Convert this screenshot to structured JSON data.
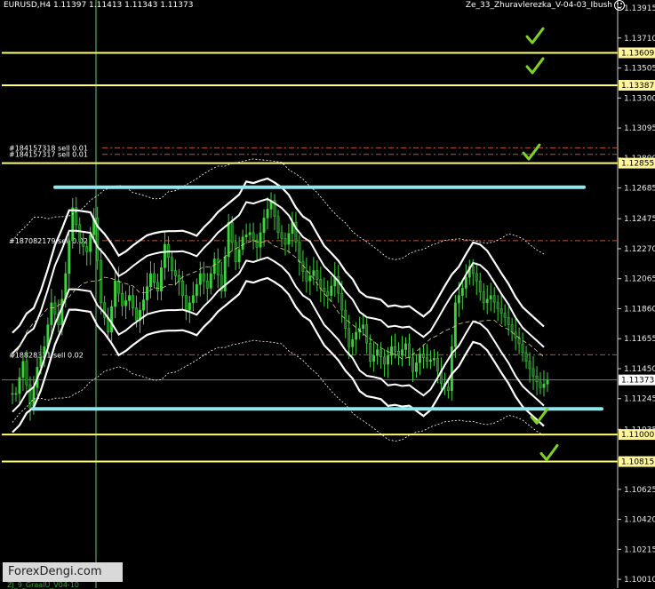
{
  "header": {
    "symbol": "EURUSD,H4  1.11397 1.11413 1.11343 1.11373",
    "indicator": "Ze_33_Zhuravlerezka_V-04-03_Ibush"
  },
  "watermark": "ForexDengi.com",
  "footer": "ZJ_9_GraalU_V04-10",
  "colors": {
    "background": "#000000",
    "candle": "#3fd23f",
    "band": "#ffffff",
    "support_resistance": "#ffff66",
    "channel": "#8ee8f0",
    "check": "#7ed321"
  },
  "chart_data": {
    "type": "candlestick",
    "symbol": "EURUSD",
    "timeframe": "H4",
    "ohlc_last": {
      "open": 1.11397,
      "high": 1.11413,
      "low": 1.11343,
      "close": 1.11373
    },
    "ylim": [
      1.0995,
      1.1397
    ],
    "y_ticks": [
      "1.13915",
      "1.13710",
      "1.13505",
      "1.13300",
      "1.13095",
      "1.12890",
      "1.12685",
      "1.12475",
      "1.12270",
      "1.12065",
      "1.11860",
      "1.11655",
      "1.11450",
      "1.11245",
      "1.11035",
      "1.10830",
      "1.10625",
      "1.10420",
      "1.10215",
      "1.10010"
    ],
    "price_labels": [
      {
        "value": 1.13609,
        "label": "1.13609",
        "kind": "yellow"
      },
      {
        "value": 1.13387,
        "label": "1.13387",
        "kind": "yellow"
      },
      {
        "value": 1.12855,
        "label": "1.12855",
        "kind": "yellow"
      },
      {
        "value": 1.11,
        "label": "1.11000",
        "kind": "yellow"
      },
      {
        "value": 1.10815,
        "label": "1.10815",
        "kind": "yellow"
      },
      {
        "value": 1.11373,
        "label": "1.11373",
        "kind": "current"
      }
    ],
    "order_lines": [
      {
        "value": 1.1296,
        "label": "#184157318 sell 0.01"
      },
      {
        "value": 1.12915,
        "label": "#184157317 sell 0.01"
      },
      {
        "value": 1.12325,
        "label": "#187082179 sell 0.02"
      },
      {
        "value": 1.11545,
        "label": "#18828331 sell 0.02"
      }
    ],
    "channel_lines": [
      {
        "from": 1.1269,
        "to": 1.1269
      },
      {
        "from": 1.11175,
        "to": 1.11175
      }
    ],
    "checkmarks": [
      1.1372,
      1.13515,
      1.12925,
      1.1112,
      1.1087
    ],
    "close_path": [
      1.1128,
      1.115,
      1.1118,
      1.1146,
      1.116,
      1.119,
      1.1175,
      1.121,
      1.1255,
      1.1232,
      1.1225,
      1.1248,
      1.119,
      1.117,
      1.1205,
      1.1188,
      1.1195,
      1.1178,
      1.1192,
      1.121,
      1.1198,
      1.123,
      1.1212,
      1.1205,
      1.1185,
      1.1195,
      1.121,
      1.12,
      1.122,
      1.1198,
      1.1245,
      1.1218,
      1.1235,
      1.1238,
      1.1228,
      1.1248,
      1.126,
      1.1238,
      1.123,
      1.1245,
      1.1218,
      1.1205,
      1.1212,
      1.12,
      1.1195,
      1.1208,
      1.1185,
      1.116,
      1.117,
      1.1175,
      1.115,
      1.1158,
      1.1148,
      1.116,
      1.1154,
      1.1162,
      1.1143,
      1.1155,
      1.115,
      1.1152,
      1.1135,
      1.113,
      1.119,
      1.12,
      1.1215,
      1.1205,
      1.119,
      1.1195,
      1.1186,
      1.118,
      1.117,
      1.1162,
      1.115,
      1.114,
      1.1132,
      1.1137
    ]
  }
}
